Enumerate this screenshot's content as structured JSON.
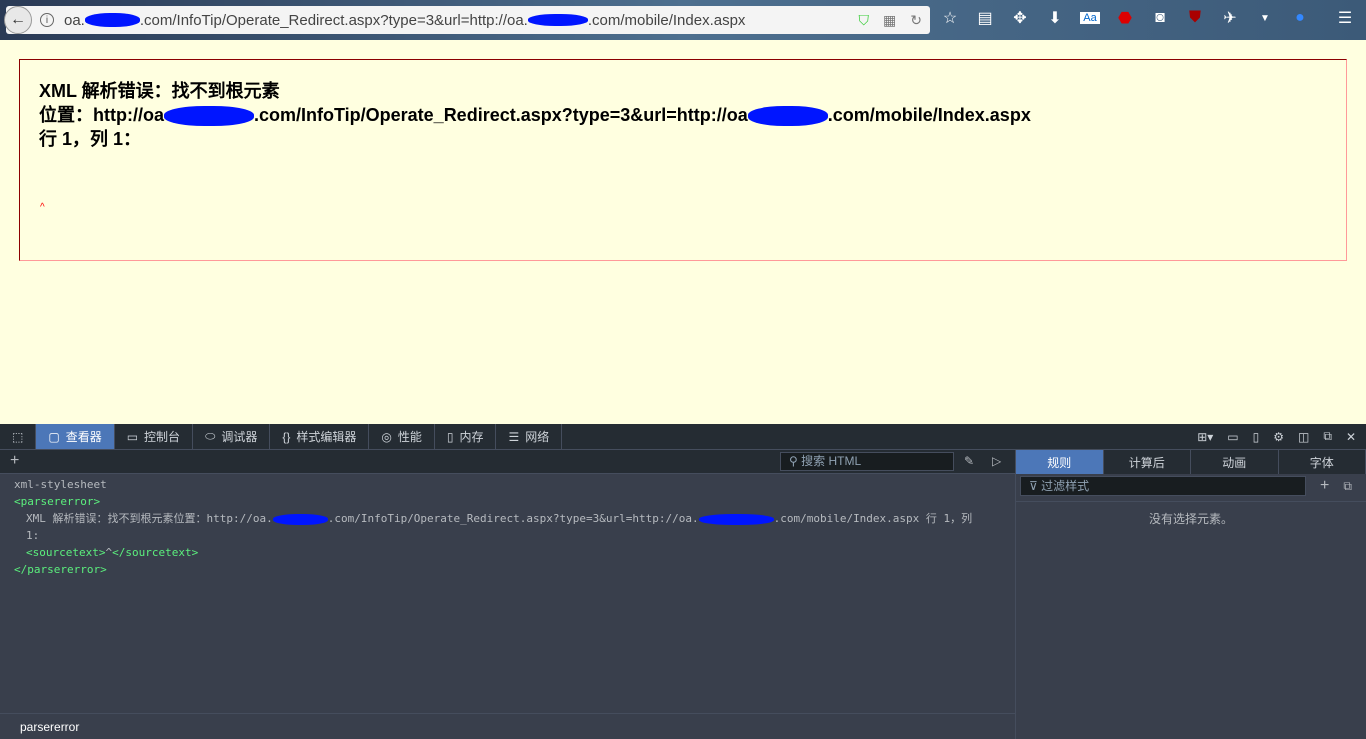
{
  "browser": {
    "url_pre": "oa.",
    "url_mid": ".com/InfoTip/Operate_Redirect.aspx?type=3&url=http://oa.",
    "url_post": ".com/mobile/Index.aspx"
  },
  "error": {
    "title": "XML 解析错误：找不到根元素",
    "loc_pre": "位置：http://oa",
    "loc_mid": ".com/InfoTip/Operate_Redirect.aspx?type=3&url=http://oa",
    "loc_post": ".com/mobile/Index.aspx",
    "line": "行 1，列 1：",
    "caret": "^"
  },
  "devtools": {
    "tabs": [
      {
        "label": "查看器"
      },
      {
        "label": "控制台"
      },
      {
        "label": "调试器"
      },
      {
        "label": "样式编辑器"
      },
      {
        "label": "性能"
      },
      {
        "label": "内存"
      },
      {
        "label": "网络"
      }
    ],
    "search_placeholder": "搜索 HTML",
    "tree": {
      "pi": "xml-stylesheet",
      "open": "<parsererror>",
      "text_pre": "XML 解析错误：找不到根元素位置：http://oa.",
      "text_mid": ".com/InfoTip/Operate_Redirect.aspx?type=3&url=http://oa.",
      "text_post": ".com/mobile/Index.aspx 行 1，列",
      "text_line2": "1:",
      "src_open": "<sourcetext>",
      "src_val": "^",
      "src_close": "</sourcetext>",
      "close": "</parsererror>"
    },
    "breadcrumb": "parsererror",
    "side_tabs": [
      {
        "label": "规则"
      },
      {
        "label": "计算后"
      },
      {
        "label": "动画"
      },
      {
        "label": "字体"
      }
    ],
    "filter_placeholder": "过滤样式",
    "empty": "没有选择元素。"
  }
}
